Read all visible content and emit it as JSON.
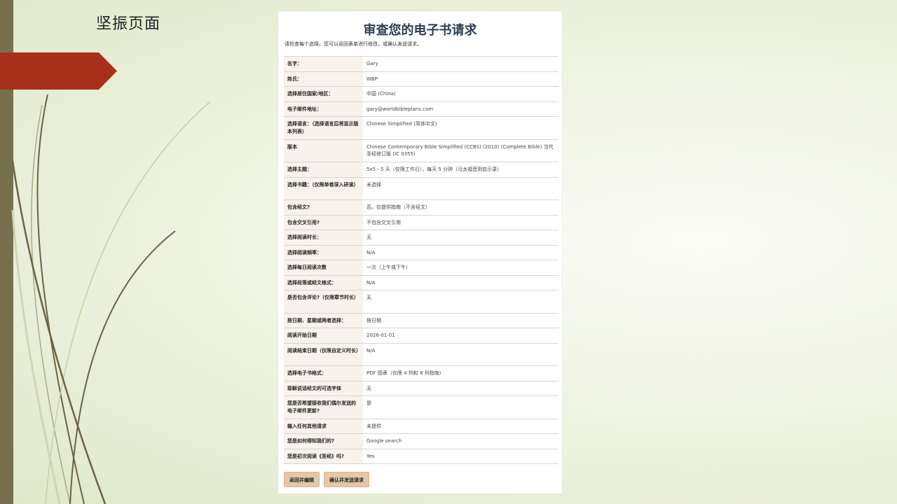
{
  "slide": {
    "title": "坚振页面"
  },
  "review": {
    "title": "审查您的电子书请求",
    "intro": "请检查每个选择。您可以返回表单进行修改，或确认发送请求。",
    "rows": [
      {
        "label": "名字：",
        "value": "Gary"
      },
      {
        "label": "姓氏：",
        "value": "WBP"
      },
      {
        "label": "选择居住国家/地区：",
        "value": "中国 (China)"
      },
      {
        "label": "电子邮件地址：",
        "value": "gary@worldbibleplans.com"
      },
      {
        "label": "选择语言：（选择语言后将显示版本列表）",
        "value": "Chinese Simplified (简体中文)"
      },
      {
        "label": "版本",
        "value": "Chinese Contemporary Bible Simplified (CCBS) (2010) (Complete Bible) 当代圣经修订版 (IC 0355)"
      },
      {
        "label": "选择主题：",
        "value": "5x5 - 5 天（仅限工作日），每天 5 分钟（马太福音到启示录）"
      },
      {
        "label": "选择书籍：（仅限单卷深入研读）",
        "value": "未选择"
      },
      {
        "label": "包含经文?",
        "value": "否。仅提供指南（不含经文）"
      },
      {
        "label": "包含交叉引用?",
        "value": "不包含交叉引用"
      },
      {
        "label": "选择阅读时长：",
        "value": "无"
      },
      {
        "label": "选择阅读频率：",
        "value": "N/A"
      },
      {
        "label": "选择每日阅读次数",
        "value": "一次（上午或下午）"
      },
      {
        "label": "选择段落或经文格式：",
        "value": "N/A"
      },
      {
        "label": "是否包含评论?（仅限章节时长）",
        "value": "无"
      },
      {
        "label": "按日期、星期或两者选择：",
        "value": "按日期"
      },
      {
        "label": "阅读开始日期",
        "value": "2026-01-01"
      },
      {
        "label": "阅读结束日期（仅限自定义时长）",
        "value": "N/A"
      },
      {
        "label": "选择电子书格式：",
        "value": "PDF 图表（仅限 4 列和 8 列指南）"
      },
      {
        "label": "耶稣说话经文的可选字体",
        "value": "无"
      },
      {
        "label": "您是否希望接收我们偶尔发送的电子邮件更新?",
        "value": "是"
      },
      {
        "label": "输入任何其他请求",
        "value": "未提供"
      },
      {
        "label": "您是如何得知我们的?",
        "value": "Google search"
      },
      {
        "label": "您是初次阅读《圣经》吗?",
        "value": "Yes"
      }
    ],
    "buttons": {
      "back": "返回并编辑",
      "confirm": "确认并发送请求"
    }
  },
  "colors": {
    "accent_red": "#a8301a",
    "side_bar": "#77704f",
    "button_bg": "#e3c9a8",
    "label_bg": "#f8f2ec",
    "title": "#2c3e50"
  }
}
